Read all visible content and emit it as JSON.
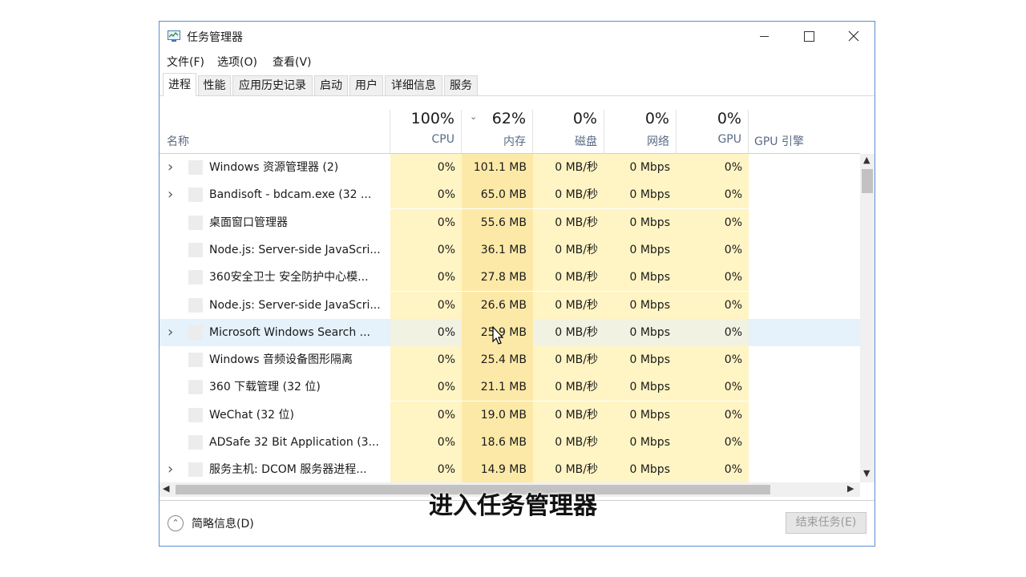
{
  "window": {
    "title": "任务管理器",
    "minimize_icon": "minimize-icon",
    "maximize_icon": "maximize-icon",
    "close_icon": "close-icon"
  },
  "menu": [
    "文件(F)",
    "选项(O)",
    "查看(V)"
  ],
  "tabs": [
    "进程",
    "性能",
    "应用历史记录",
    "启动",
    "用户",
    "详细信息",
    "服务"
  ],
  "active_tab": "进程",
  "columns": {
    "name": "名称",
    "cpu": {
      "pct": "100%",
      "label": "CPU"
    },
    "memory": {
      "pct": "62%",
      "label": "内存"
    },
    "disk": {
      "pct": "0%",
      "label": "磁盘"
    },
    "network": {
      "pct": "0%",
      "label": "网络"
    },
    "gpu": {
      "pct": "0%",
      "label": "GPU"
    },
    "gpu_engine": "GPU 引擎"
  },
  "processes": [
    {
      "expand": true,
      "name": "Windows 资源管理器 (2)",
      "cpu": "0%",
      "mem": "101.1 MB",
      "disk": "0 MB/秒",
      "net": "0 Mbps",
      "gpu": "0%"
    },
    {
      "expand": true,
      "name": "Bandisoft - bdcam.exe (32 ...",
      "cpu": "0%",
      "mem": "65.0 MB",
      "disk": "0 MB/秒",
      "net": "0 Mbps",
      "gpu": "0%"
    },
    {
      "expand": false,
      "name": "桌面窗口管理器",
      "cpu": "0%",
      "mem": "55.6 MB",
      "disk": "0 MB/秒",
      "net": "0 Mbps",
      "gpu": "0%"
    },
    {
      "expand": false,
      "name": "Node.js: Server-side JavaScri...",
      "cpu": "0%",
      "mem": "36.1 MB",
      "disk": "0 MB/秒",
      "net": "0 Mbps",
      "gpu": "0%"
    },
    {
      "expand": false,
      "name": "360安全卫士 安全防护中心模...",
      "cpu": "0%",
      "mem": "27.8 MB",
      "disk": "0 MB/秒",
      "net": "0 Mbps",
      "gpu": "0%"
    },
    {
      "expand": false,
      "name": "Node.js: Server-side JavaScri...",
      "cpu": "0%",
      "mem": "26.6 MB",
      "disk": "0 MB/秒",
      "net": "0 Mbps",
      "gpu": "0%"
    },
    {
      "expand": true,
      "name": "Microsoft Windows Search ...",
      "cpu": "0%",
      "mem": "25.9 MB",
      "disk": "0 MB/秒",
      "net": "0 Mbps",
      "gpu": "0%",
      "selected": true
    },
    {
      "expand": false,
      "name": "Windows 音频设备图形隔离",
      "cpu": "0%",
      "mem": "25.4 MB",
      "disk": "0 MB/秒",
      "net": "0 Mbps",
      "gpu": "0%"
    },
    {
      "expand": false,
      "name": "360 下载管理 (32 位)",
      "cpu": "0%",
      "mem": "21.1 MB",
      "disk": "0 MB/秒",
      "net": "0 Mbps",
      "gpu": "0%"
    },
    {
      "expand": false,
      "name": "WeChat (32 位)",
      "cpu": "0%",
      "mem": "19.0 MB",
      "disk": "0 MB/秒",
      "net": "0 Mbps",
      "gpu": "0%"
    },
    {
      "expand": false,
      "name": "ADSafe 32 Bit Application (3...",
      "cpu": "0%",
      "mem": "18.6 MB",
      "disk": "0 MB/秒",
      "net": "0 Mbps",
      "gpu": "0%"
    },
    {
      "expand": true,
      "name": "服务主机: DCOM 服务器进程...",
      "cpu": "0%",
      "mem": "14.9 MB",
      "disk": "0 MB/秒",
      "net": "0 Mbps",
      "gpu": "0%"
    }
  ],
  "footer": {
    "fewer_details": "简略信息(D)",
    "end_task": "结束任务(E)"
  },
  "caption": "进入任务管理器",
  "colors": {
    "heat_light": "#fff4c4",
    "heat_mem": "#fce9a8",
    "selected_row": "#e5f1fb",
    "window_border": "#5a8fd0"
  }
}
